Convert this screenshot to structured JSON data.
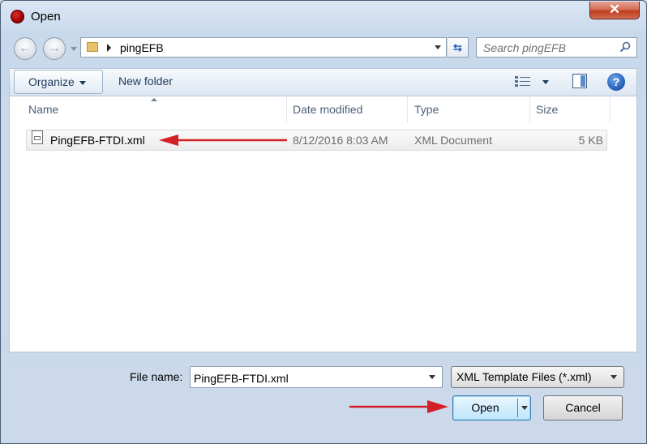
{
  "window": {
    "title": "Open",
    "close_glyph": "✕"
  },
  "navigation": {
    "back_glyph": "←",
    "forward_glyph": "→",
    "breadcrumb": [
      "pingEFB"
    ],
    "refresh_glyph": "⇆"
  },
  "search": {
    "placeholder": "Search pingEFB"
  },
  "toolbar": {
    "organize_label": "Organize",
    "new_folder_label": "New folder",
    "help_glyph": "?"
  },
  "file_list": {
    "columns": [
      "Name",
      "Date modified",
      "Type",
      "Size"
    ],
    "rows": [
      {
        "name": "PingEFB-FTDI.xml",
        "date_modified": "8/12/2016 8:03 AM",
        "type": "XML Document",
        "size": "5 KB"
      }
    ]
  },
  "footer": {
    "file_name_label": "File name:",
    "file_name_value": "PingEFB-FTDI.xml",
    "file_type_filter": "XML Template Files (*.xml)",
    "open_label": "Open",
    "cancel_label": "Cancel"
  },
  "colors": {
    "accent_arrow": "#d32026",
    "title_text": "#000000",
    "link_text": "#1e395b"
  },
  "icons": [
    "app-icon",
    "close-icon",
    "back-icon",
    "forward-icon",
    "folder-icon",
    "refresh-icon",
    "search-icon",
    "views-icon",
    "preview-pane-icon",
    "help-icon",
    "xml-file-icon",
    "annotation-arrow"
  ]
}
